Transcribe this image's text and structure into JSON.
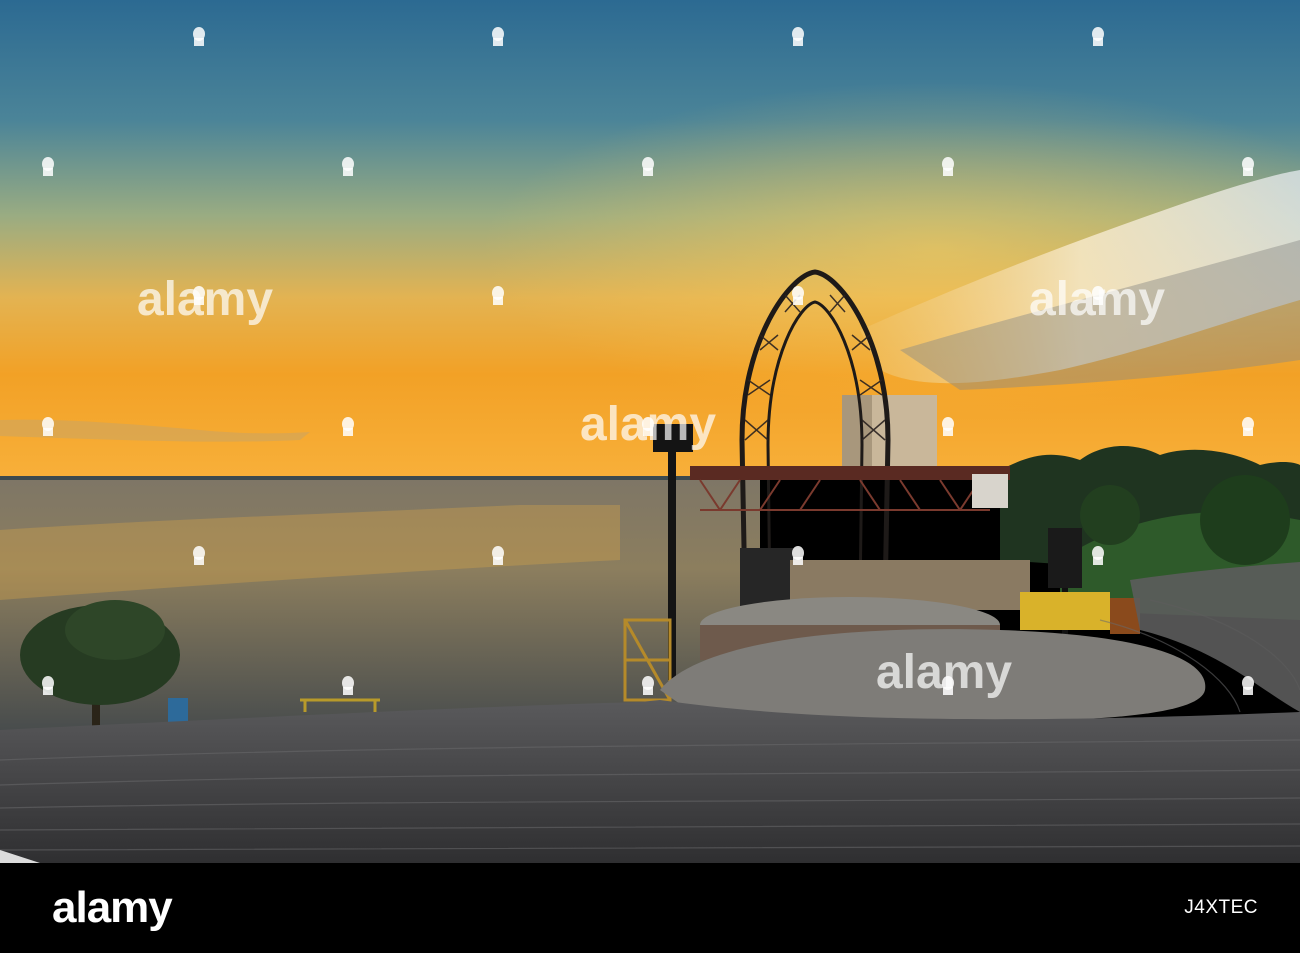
{
  "photo": {
    "subject": "sunset over river with amphitheater stage and steel arch",
    "colors": {
      "sky_top": "#2f6f94",
      "sky_mid": "#8fa98a",
      "sky_horizon": "#f4a21f",
      "water": "#6b6a5e",
      "steps": "#4a4a4c",
      "cloud": "#e8d8a8"
    }
  },
  "watermark": {
    "text": "alamy",
    "brand_color": "#ffffff"
  },
  "footer": {
    "logo_text": "alamy",
    "image_id": "J4XTEC",
    "background": "#000000"
  }
}
